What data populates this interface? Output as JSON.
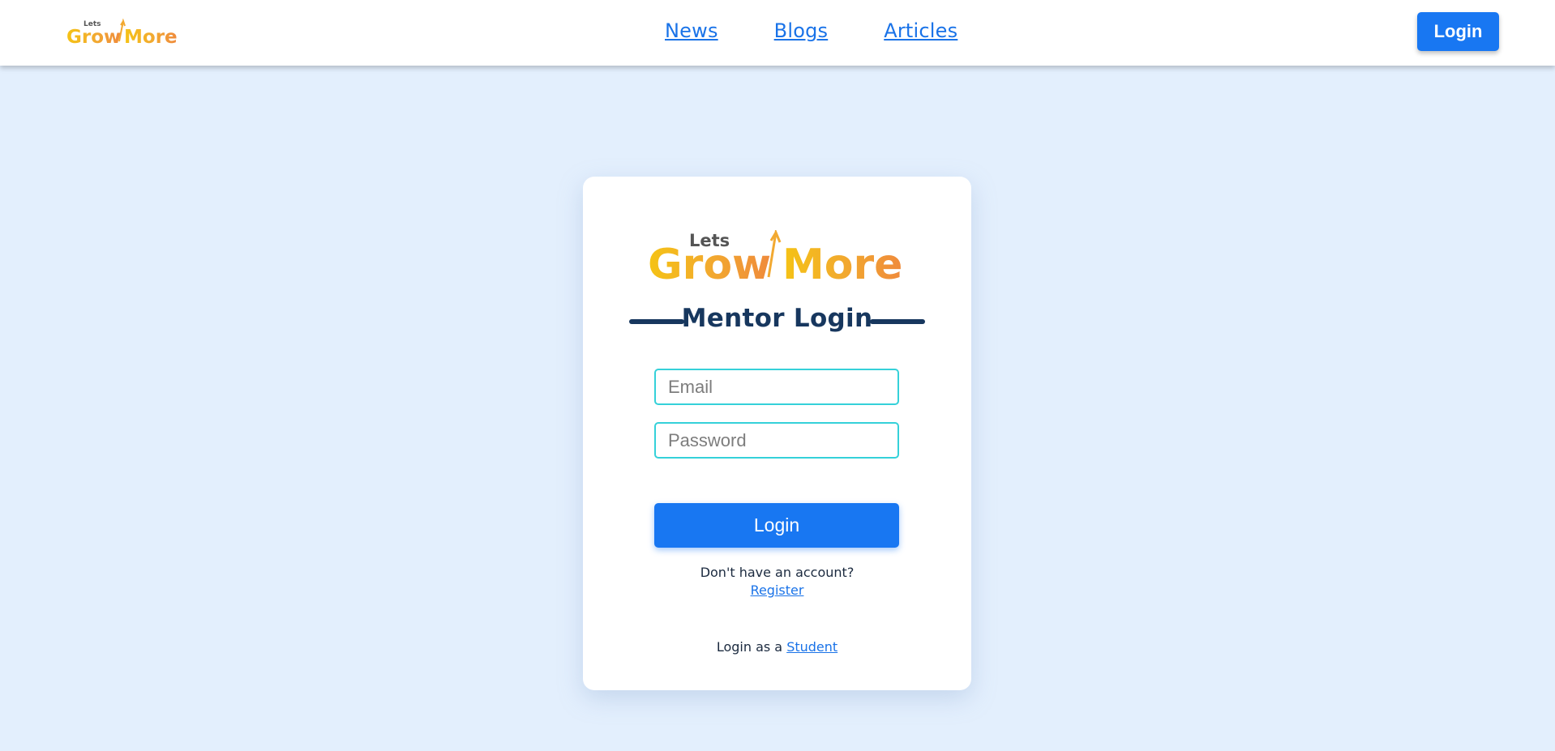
{
  "header": {
    "logo": {
      "top_text": "Lets",
      "grow": "Grow",
      "more": "More"
    },
    "nav": [
      {
        "label": "News"
      },
      {
        "label": "Blogs"
      },
      {
        "label": "Articles"
      }
    ],
    "login_label": "Login"
  },
  "card": {
    "logo": {
      "top_text": "Lets",
      "grow": "Grow",
      "more": "More"
    },
    "title": "Mentor Login",
    "email_placeholder": "Email",
    "password_placeholder": "Password",
    "submit_label": "Login",
    "no_account_text": "Don't have an account?",
    "register_label": "Register",
    "student_prefix": "Login as a",
    "student_link": "Student"
  },
  "colors": {
    "background": "#e3effd",
    "primary": "#1877f2",
    "title": "#17375e",
    "field_border": "#35d1d9",
    "logo_gold": "#f5c315",
    "logo_orange": "#ef8a3c"
  }
}
